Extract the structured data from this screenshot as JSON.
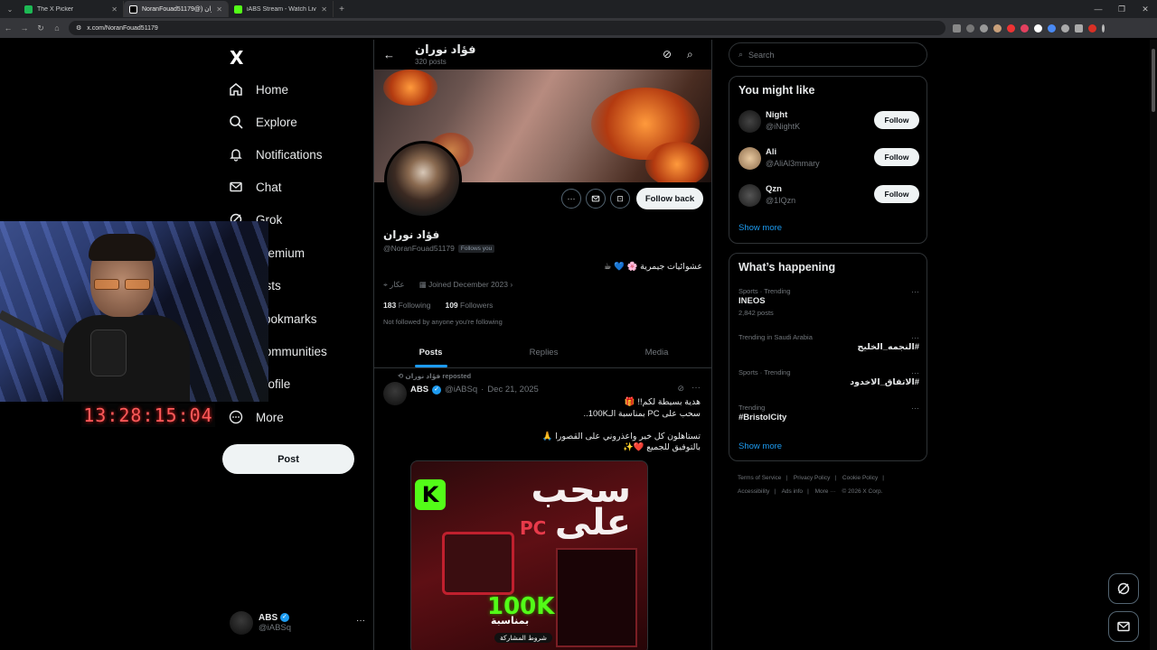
{
  "browser": {
    "tabs": [
      {
        "title": "The X Picker",
        "color": "#1db954"
      },
      {
        "title": "NoranFouad51179@) فؤاد نوران",
        "color": "#ffffff"
      },
      {
        "title": "iABS Stream - Watch Live on Ki",
        "color": "#53fc18"
      }
    ],
    "url": "x.com/NoranFouad51179"
  },
  "nav": {
    "logo": "X",
    "items": [
      {
        "label": "Home",
        "icon": "home-icon"
      },
      {
        "label": "Explore",
        "icon": "search-icon"
      },
      {
        "label": "Notifications",
        "icon": "bell-icon"
      },
      {
        "label": "Chat",
        "icon": "mail-icon"
      },
      {
        "label": "Grok",
        "icon": "grok-icon"
      },
      {
        "label": "Premium",
        "icon": "x-icon"
      },
      {
        "label": "Lists",
        "icon": "list-icon"
      },
      {
        "label": "Bookmarks",
        "icon": "bookmark-icon"
      },
      {
        "label": "Communities",
        "icon": "people-icon"
      },
      {
        "label": "Profile",
        "icon": "person-icon"
      },
      {
        "label": "More",
        "icon": "more-circle-icon"
      }
    ],
    "post_label": "Post",
    "account": {
      "name": "ABS",
      "handle": "@iABSq"
    }
  },
  "webcam": {
    "timer": "13:28:15:04"
  },
  "profile": {
    "title": "فؤاد نوران",
    "posts_count": "320 posts",
    "name": "فؤاد نوران",
    "handle": "@NoranFouad51179",
    "follows_you": "Follows you",
    "bio": "عشوائيات جيمرية 🌸 💙 ☕",
    "location": "عكار",
    "joined": "Joined December 2023",
    "following_count": "183",
    "following_label": "Following",
    "followers_count": "109",
    "followers_label": "Followers",
    "not_followed": "Not followed by anyone you’re following",
    "follow_back": "Follow back",
    "tabs": [
      "Posts",
      "Replies",
      "Media"
    ]
  },
  "tweet": {
    "repost_line": "فؤاد نوران reposted",
    "author": "ABS",
    "handle": "@iABSq",
    "date": "Dec 21, 2025",
    "text": "هدية بسيطة لكم!! 🎁\nسحب على PC بمناسبة الـ100K..\n\nتستاهلون كل خير واعذروني على القصورا 🙏\nبالتوفيق للجميع ❤️✨",
    "image": {
      "title_line1": "سحب",
      "title_line2": "على",
      "pc": "PC",
      "k": "K",
      "big": "100K",
      "occasion": "بمناسبة",
      "terms": "شروط المشاركة"
    }
  },
  "right": {
    "search_placeholder": "Search",
    "you_might_like": "You might like",
    "suggestions": [
      {
        "name": "Night",
        "handle": "@iNightK",
        "follow": "Follow"
      },
      {
        "name": "Ali",
        "handle": "@AliAl3mmary",
        "follow": "Follow"
      },
      {
        "name": "Qzn",
        "handle": "@1IQzn",
        "follow": "Follow"
      }
    ],
    "show_more": "Show more",
    "whats_happening": "What’s happening",
    "trends": [
      {
        "context": "Sports · Trending",
        "name": "INEOS",
        "count": "2,842 posts",
        "dir": "ltr"
      },
      {
        "context": "Trending in Saudi Arabia",
        "name": "#النجمه_الخليج",
        "count": "",
        "dir": "rtl"
      },
      {
        "context": "Sports · Trending",
        "name": "#الاتفاق_الاخدود",
        "count": "",
        "dir": "rtl"
      },
      {
        "context": "Trending",
        "name": "#BristolCity",
        "count": "",
        "dir": "ltr"
      }
    ],
    "show_more_2": "Show more",
    "footer": [
      "Terms of Service",
      "|",
      "Privacy Policy",
      "|",
      "Cookie Policy",
      "|",
      "Accessibility",
      "|",
      "Ads info",
      "|",
      "More ···",
      "© 2026 X Corp."
    ]
  }
}
